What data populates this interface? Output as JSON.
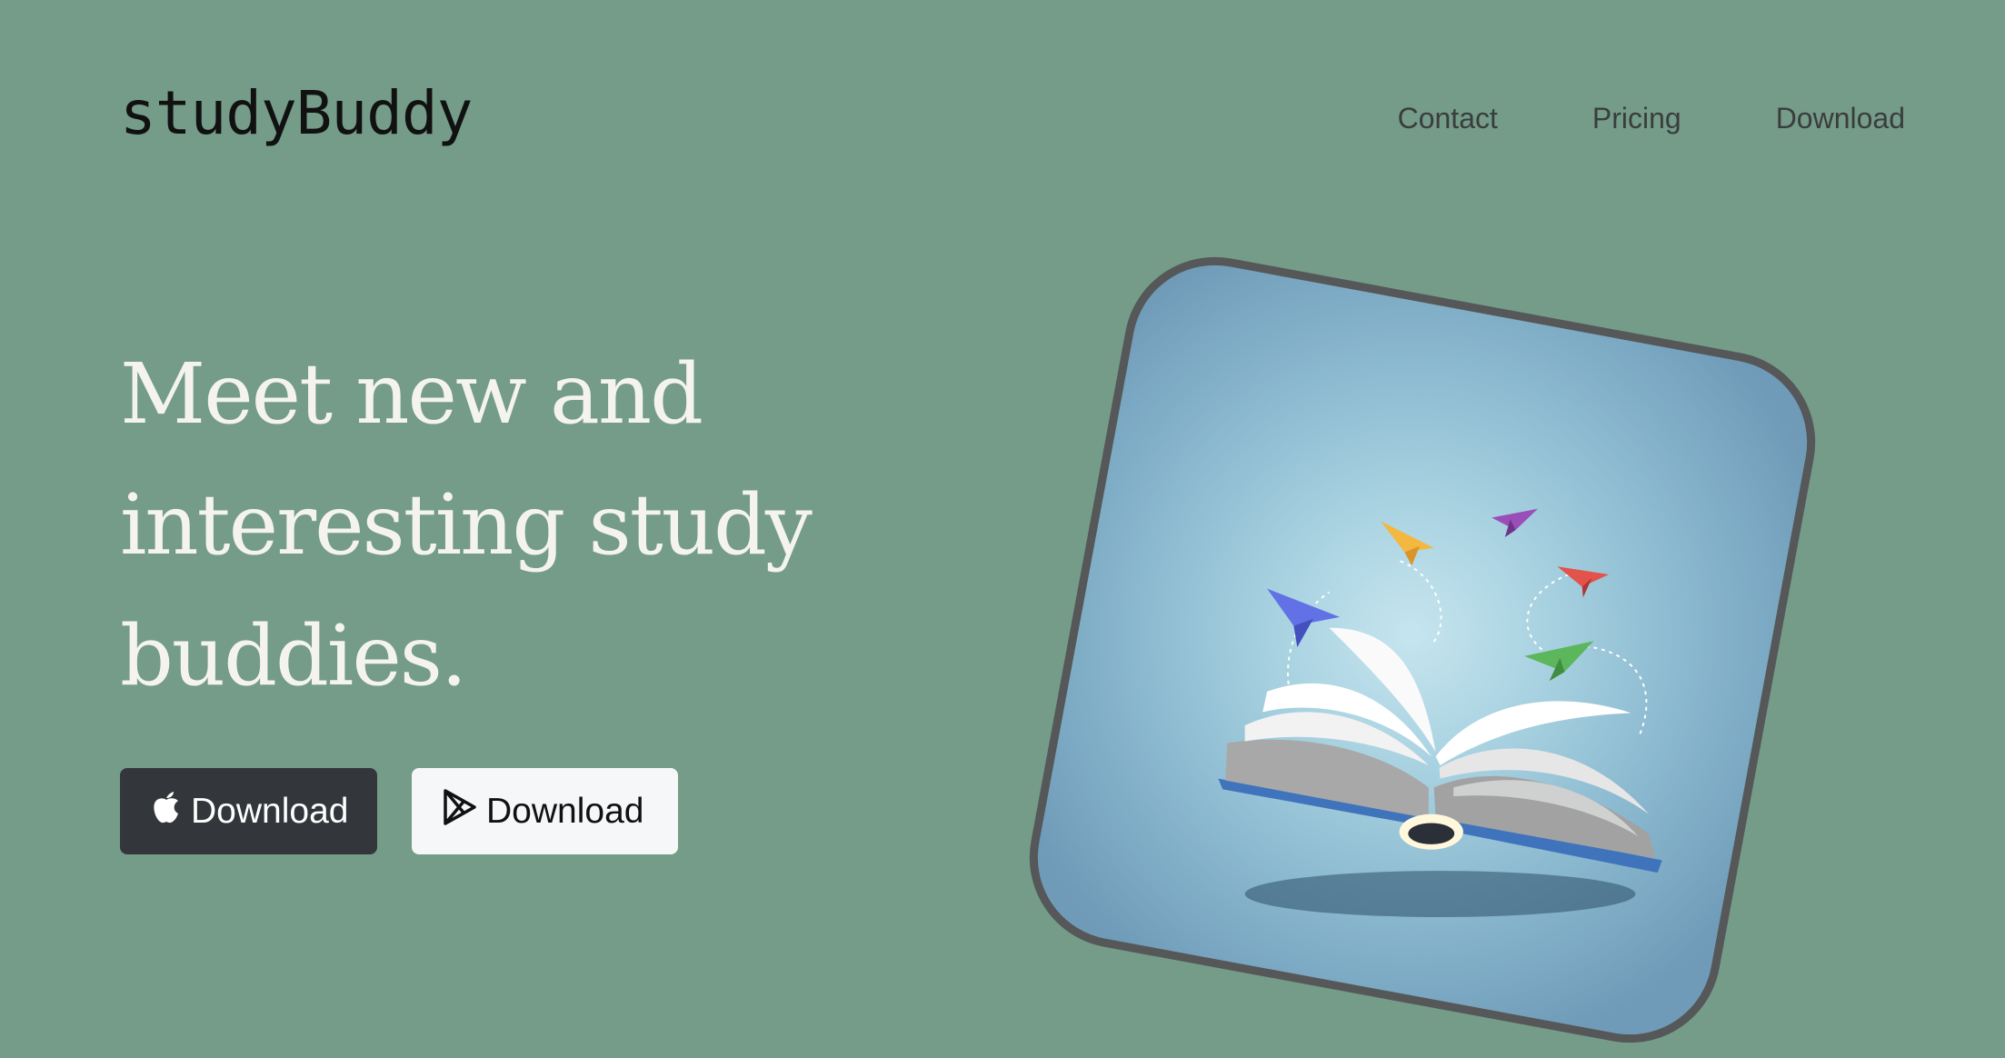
{
  "header": {
    "logo": "studyBuddy",
    "nav": [
      "Contact",
      "Pricing",
      "Download"
    ]
  },
  "hero": {
    "title": "Meet new and interesting study buddies.",
    "buttons": {
      "ios_label": "Download",
      "android_label": "Download"
    },
    "image": {
      "subject": "open book with colorful paper airplanes",
      "icons": [
        "apple-icon",
        "google-play-icon"
      ]
    }
  },
  "colors": {
    "background": "#749c88",
    "title": "#f4f3ef",
    "ios_button": "#33373b",
    "android_button": "#f6f7f8",
    "card_border": "#555759"
  }
}
